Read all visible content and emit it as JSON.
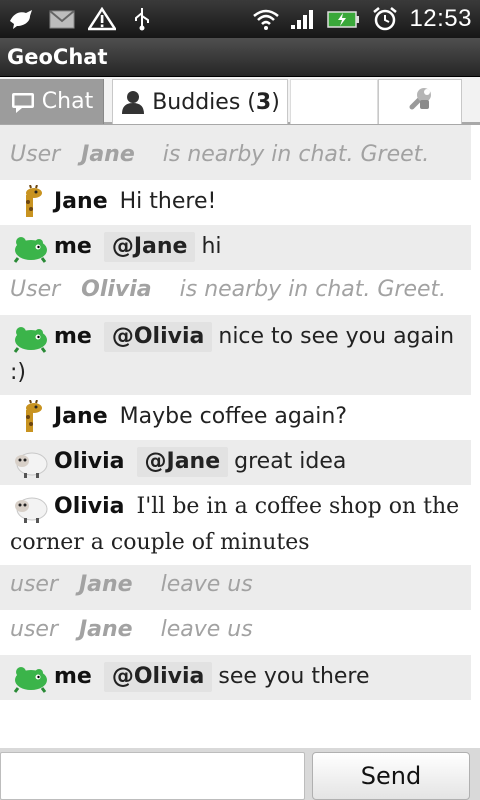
{
  "status_bar": {
    "time": "12:53",
    "icons": [
      "bird-icon",
      "mail-icon",
      "warning-icon",
      "usb-icon",
      "wifi-icon",
      "signal-icon",
      "battery-charging-icon",
      "alarm-icon"
    ]
  },
  "app": {
    "title": "GeoChat"
  },
  "tabs": {
    "chat": {
      "label": "Chat",
      "icon": "chat-bubble-icon"
    },
    "buddies": {
      "label": "Buddies",
      "count": "3",
      "icon": "person-icon"
    },
    "settings": {
      "icon": "wrench-icon"
    }
  },
  "messages": [
    {
      "type": "system",
      "prefix": "User",
      "name": "Jane",
      "text": "is nearby in chat. Greet."
    },
    {
      "type": "chat",
      "sender": "Jane",
      "avatar": "giraffe-avatar",
      "mention": "",
      "text": "Hi there!"
    },
    {
      "type": "chat",
      "sender": "me",
      "avatar": "green-creature-avatar",
      "mention": "@Jane",
      "text": "hi"
    },
    {
      "type": "system",
      "prefix": "User",
      "name": "Olivia",
      "text": "is nearby in chat. Greet."
    },
    {
      "type": "chat",
      "sender": "me",
      "avatar": "green-creature-avatar",
      "mention": "@Olivia",
      "text": "nice to see you again :)"
    },
    {
      "type": "chat",
      "sender": "Jane",
      "avatar": "giraffe-avatar",
      "mention": "",
      "text": "Maybe coffee again?"
    },
    {
      "type": "chat",
      "sender": "Olivia",
      "avatar": "sheep-avatar",
      "mention": "@Jane",
      "text": "great idea"
    },
    {
      "type": "chat",
      "sender": "Olivia",
      "avatar": "sheep-avatar",
      "mention": "",
      "text": "I'll be in a coffee shop on the corner a couple of minutes"
    },
    {
      "type": "system",
      "prefix": "user",
      "name": "Jane",
      "text": "leave us"
    },
    {
      "type": "system",
      "prefix": "user",
      "name": "Jane",
      "text": "leave us"
    },
    {
      "type": "chat",
      "sender": "me",
      "avatar": "green-creature-avatar",
      "mention": "@Olivia",
      "text": "see you there"
    }
  ],
  "input": {
    "placeholder": "",
    "value": ""
  },
  "send": {
    "label": "Send"
  },
  "colors": {
    "row_alt": "#ececec",
    "system_text": "#a2a2a2",
    "tab_active": "#9c9c9c",
    "mention_bg": "#e2e2e2"
  }
}
